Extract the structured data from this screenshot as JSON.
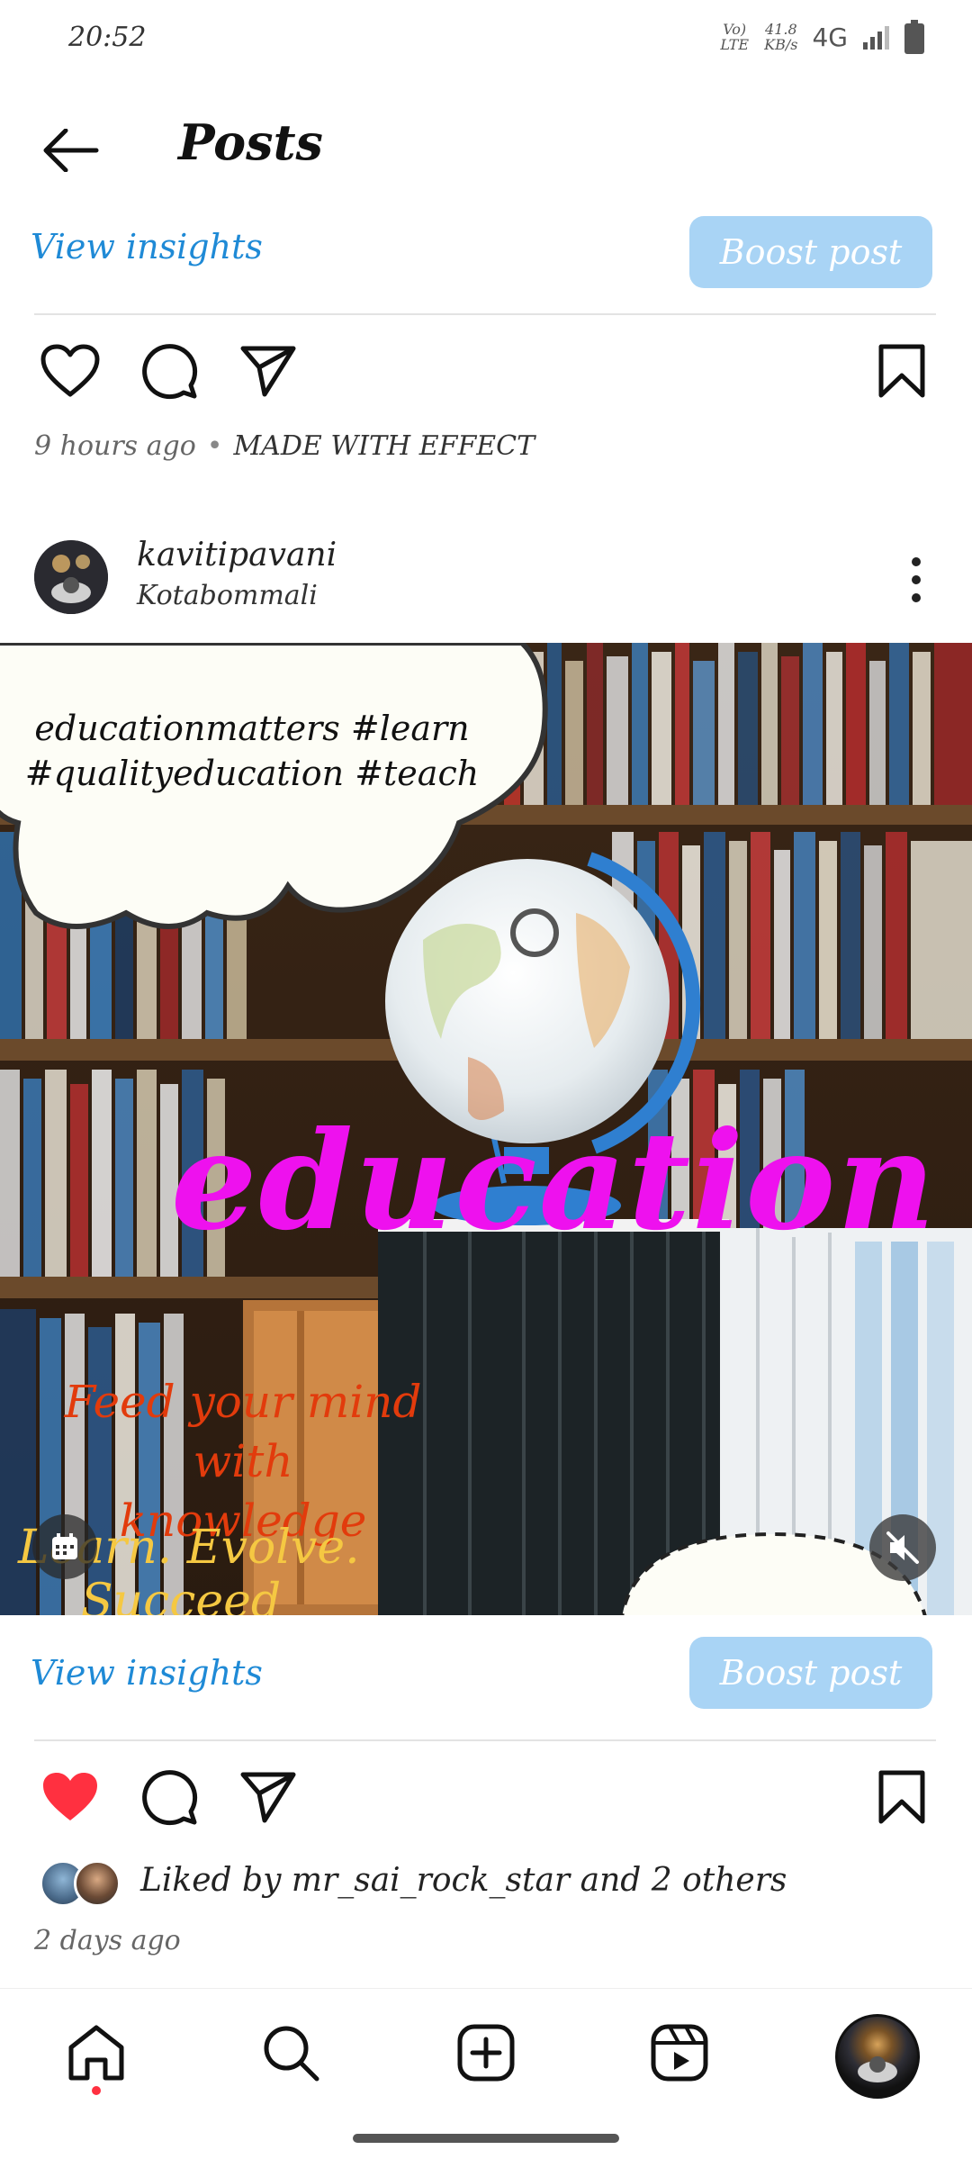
{
  "status_bar": {
    "time": "20:52",
    "volte": "Vo) LTE",
    "speed_value": "41.8",
    "speed_unit": "KB/s",
    "network": "4G"
  },
  "header": {
    "title": "Posts"
  },
  "prev_post": {
    "view_insights": "View insights",
    "boost_post": "Boost post",
    "time_ago": "9 hours ago",
    "separator": "•",
    "effect_label": "MADE WITH EFFECT"
  },
  "post": {
    "username": "kavitipavani",
    "location": "Kotabommali",
    "image": {
      "cloud_line1": "educationmatters #learn",
      "cloud_line2": "#qualityeducation #teach",
      "headline": "education",
      "feed_line1": "Feed your mind with",
      "feed_line2": "knowledge",
      "learn_line1": "Learn. Evolve.",
      "learn_line2": "Succeed"
    },
    "view_insights": "View insights",
    "boost_post": "Boost post",
    "liked_by_prefix": "Liked by",
    "liked_by_user": "mr_sai_rock_star",
    "liked_by_suffix": "and 2 others",
    "time_ago": "2 days ago",
    "liked": true
  },
  "colors": {
    "link_blue": "#1f8ad6",
    "boost_bg": "#a9d4f5",
    "like_red": "#ff3040",
    "headline_magenta": "#ee11ee"
  },
  "nav": [
    "home-icon",
    "search-icon",
    "create-icon",
    "reels-icon",
    "profile-avatar"
  ]
}
